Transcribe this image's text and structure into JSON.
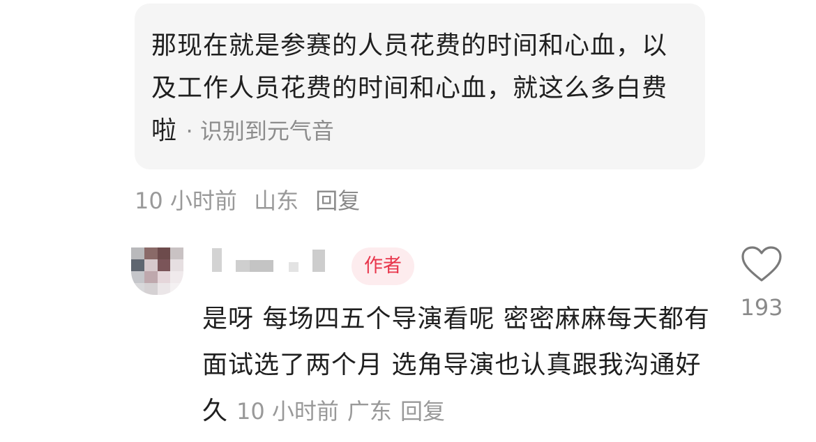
{
  "parent_comment": {
    "text": "那现在就是参赛的人员花费的时间和心血，以及工作人员花费的时间和心血，就这么多白费啦",
    "voice_tag": "· 识别到元气音",
    "time": "10 小时前",
    "location": "山东",
    "reply_label": "回复"
  },
  "reply_comment": {
    "avatar_icon": "blurred-avatar",
    "username_display": "blurred",
    "author_badge": "作者",
    "text": "是呀 每场四五个导演看呢 密密麻麻每天都有面试选了两个月 选角导演也认真跟我沟通好久",
    "time": "10 小时前",
    "location": "广东",
    "reply_label": "回复",
    "like_icon": "heart-outline-icon",
    "like_count": "193"
  },
  "colors": {
    "bubble_bg": "#f5f5f5",
    "meta_gray": "#999999",
    "badge_bg": "#fdecee",
    "badge_text": "#e8364c"
  }
}
